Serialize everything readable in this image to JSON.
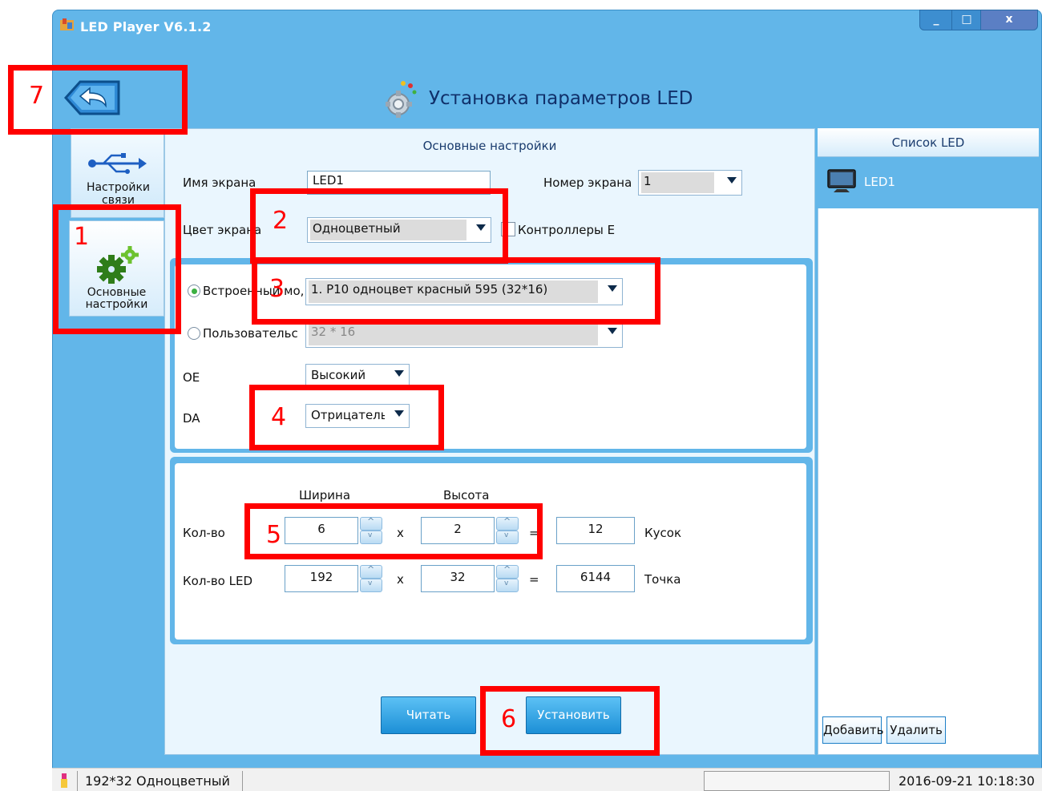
{
  "window": {
    "title": "LED Player V6.1.2",
    "controls": {
      "minimize": "_",
      "maximize": "□",
      "close": "x"
    }
  },
  "header": {
    "title": "Установка параметров LED"
  },
  "nav": {
    "items": [
      {
        "label_line1": "Настройки",
        "label_line2": "связи",
        "icon": "usb-icon"
      },
      {
        "label_line1": "Основные",
        "label_line2": "настройки",
        "icon": "settings-gears-icon"
      }
    ]
  },
  "main": {
    "section_title": "Основные настройки",
    "screen_name_label": "Имя экрана",
    "screen_name_value": "LED1",
    "screen_number_label": "Номер экрана",
    "screen_number_value": "1",
    "screen_color_label": "Цвет экрана",
    "screen_color_value": "Одноцветный",
    "controllers_label": "Контроллеры E",
    "builtin_label": "Встроенный мо,",
    "builtin_value": "1. P10 одноцвет красный 595 (32*16)",
    "custom_label": "Пользовательс",
    "custom_value": "32 * 16",
    "oe_label": "OE",
    "oe_value": "Высокий",
    "da_label": "DA",
    "da_value": "Отрицатель",
    "width_header": "Ширина",
    "height_header": "Высота",
    "count_label": "Кол-во",
    "count_w": "6",
    "count_h": "2",
    "count_total": "12",
    "count_unit": "Кусок",
    "led_label": "Кол-во LED",
    "led_w": "192",
    "led_h": "32",
    "led_total": "6144",
    "led_unit": "Точка",
    "times_sign": "x",
    "equals_sign": "=",
    "read_button": "Читать",
    "set_button": "Установить"
  },
  "list": {
    "title": "Список LED",
    "items": [
      "LED1"
    ],
    "add_button": "Добавить",
    "delete_button": "Удалить"
  },
  "status": {
    "info": "192*32 Одноцветный",
    "datetime": "2016-09-21 10:18:30"
  },
  "annotations": [
    "1",
    "2",
    "3",
    "4",
    "5",
    "6",
    "7"
  ],
  "colors": {
    "window_blue": "#62b6e9",
    "annotation_red": "#ff0000",
    "button_blue": "#1c8fd6"
  }
}
